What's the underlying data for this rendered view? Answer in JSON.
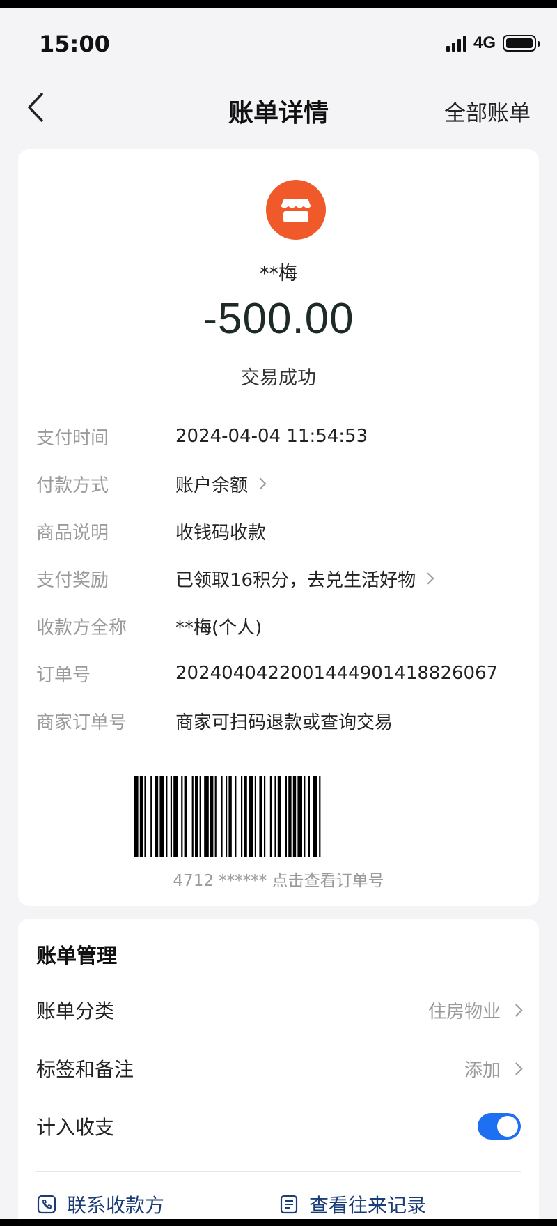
{
  "status_bar": {
    "time": "15:00",
    "network": "4G"
  },
  "nav": {
    "title": "账单详情",
    "right_link": "全部账单"
  },
  "merchant": {
    "name": "**梅",
    "icon": "store-icon",
    "icon_color": "#f0592a"
  },
  "amount": "-500.00",
  "trans_status": "交易成功",
  "details": [
    {
      "label": "支付时间",
      "value": "2024-04-04 11:54:53",
      "has_arrow": false
    },
    {
      "label": "付款方式",
      "value": "账户余额",
      "has_arrow": true
    },
    {
      "label": "商品说明",
      "value": "收钱码收款",
      "has_arrow": false
    },
    {
      "label": "支付奖励",
      "value": "已领取16积分，去兑生活好物",
      "has_arrow": true
    },
    {
      "label": "收款方全称",
      "value": "**梅(个人)",
      "has_arrow": false
    },
    {
      "label": "订单号",
      "value": "2024040422001444901418826067",
      "has_arrow": false
    },
    {
      "label": "商家订单号",
      "value": "商家可扫码退款或查询交易",
      "has_arrow": false
    }
  ],
  "barcode_caption": "4712 ****** 点击查看订单号",
  "manage": {
    "title": "账单管理",
    "category": {
      "label": "账单分类",
      "value": "住房物业"
    },
    "tags": {
      "label": "标签和备注",
      "value": "添加"
    },
    "count": {
      "label": "计入收支",
      "enabled": true
    }
  },
  "actions": {
    "contact": "联系收款方",
    "history": "查看往来记录"
  },
  "colors": {
    "accent": "#1e6ff2",
    "link": "#1a3d78"
  }
}
